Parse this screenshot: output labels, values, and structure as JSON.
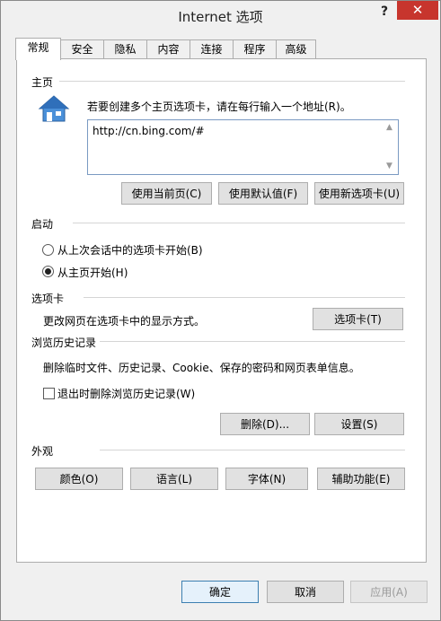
{
  "window": {
    "title": "Internet 选项",
    "help": "?",
    "close": "✕"
  },
  "tabs": [
    "常规",
    "安全",
    "隐私",
    "内容",
    "连接",
    "程序",
    "高级"
  ],
  "home": {
    "group": "主页",
    "instruction": "若要创建多个主页选项卡，请在每行输入一个地址(R)。",
    "url_value": "http://cn.bing.com/#",
    "buttons": [
      "使用当前页(C)",
      "使用默认值(F)",
      "使用新选项卡(U)"
    ]
  },
  "startup": {
    "group": "启动",
    "options": [
      "从上次会话中的选项卡开始(B)",
      "从主页开始(H)"
    ],
    "selected": 1
  },
  "tabs_group": {
    "group": "选项卡",
    "desc": "更改网页在选项卡中的显示方式。",
    "button": "选项卡(T)"
  },
  "history": {
    "group": "浏览历史记录",
    "desc": "删除临时文件、历史记录、Cookie、保存的密码和网页表单信息。",
    "checkbox": "退出时删除浏览历史记录(W)",
    "checked": false,
    "delete_btn": "删除(D)...",
    "settings_btn": "设置(S)"
  },
  "appearance": {
    "group": "外观",
    "buttons": [
      "颜色(O)",
      "语言(L)",
      "字体(N)",
      "辅助功能(E)"
    ]
  },
  "footer": {
    "ok": "确定",
    "cancel": "取消",
    "apply": "应用(A)"
  },
  "colors": {
    "close_bg": "#c7352d",
    "window_bg": "#f0f0f0",
    "panel_bg": "#ffffff"
  }
}
